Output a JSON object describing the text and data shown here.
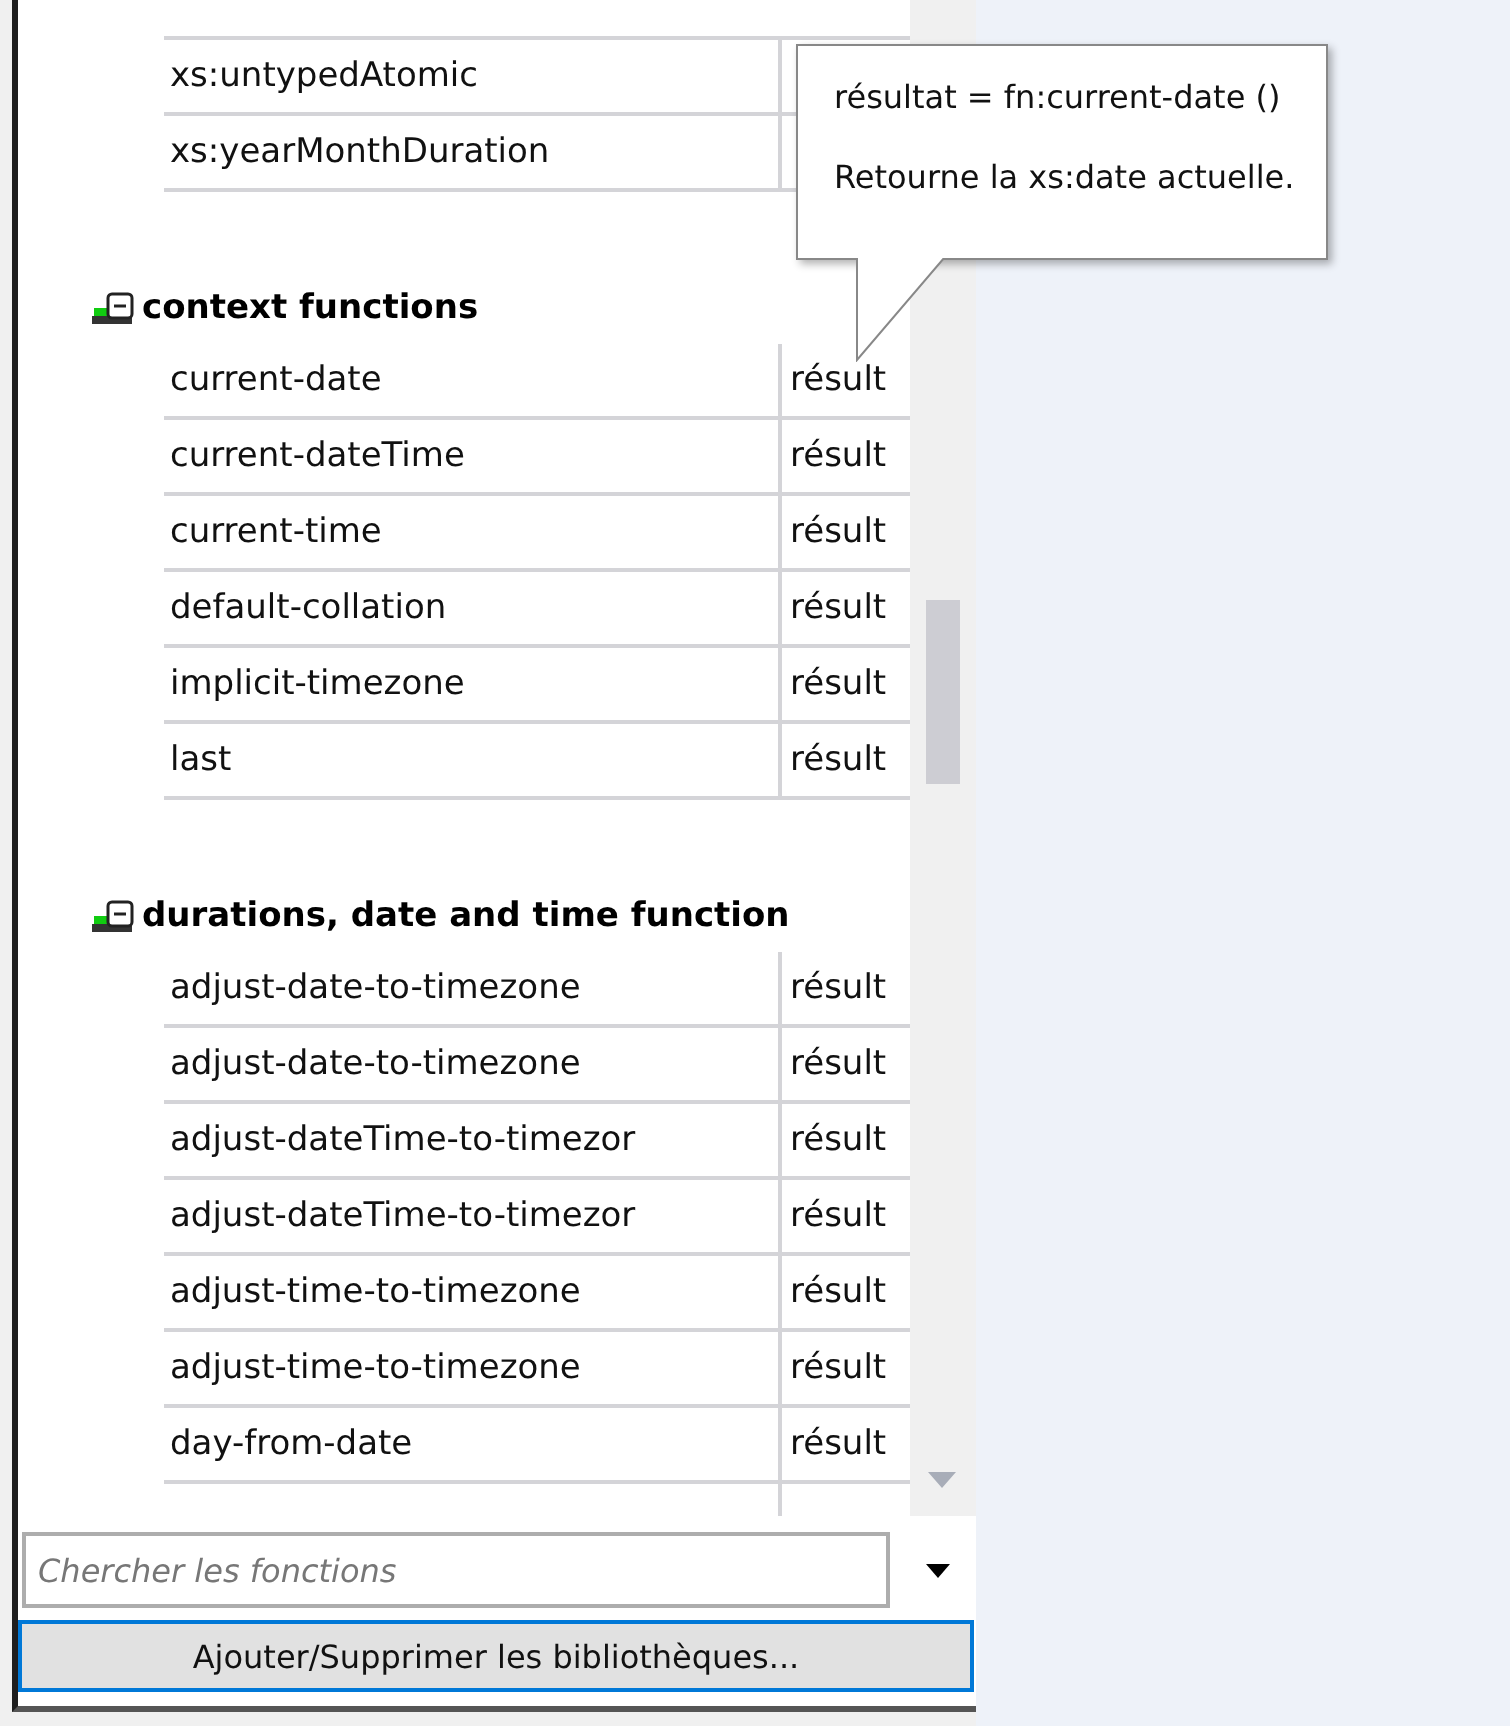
{
  "function_list": {
    "sections": [
      {
        "rows": [
          {
            "name": "xs:untypedAtomic"
          },
          {
            "name": "xs:yearMonthDuration"
          }
        ]
      },
      {
        "title": "context functions",
        "expanded": true,
        "rows": [
          {
            "name": "current-date",
            "result": "résult"
          },
          {
            "name": "current-dateTime",
            "result": "résult"
          },
          {
            "name": "current-time",
            "result": "résult"
          },
          {
            "name": "default-collation",
            "result": "résult"
          },
          {
            "name": "implicit-timezone",
            "result": "résult"
          },
          {
            "name": "last",
            "result": "résult"
          }
        ]
      },
      {
        "title": "durations, date and time function",
        "expanded": true,
        "rows": [
          {
            "name": "adjust-date-to-timezone",
            "result": "résult"
          },
          {
            "name": "adjust-date-to-timezone",
            "result": "résult"
          },
          {
            "name": "adjust-dateTime-to-timezor",
            "result": "résult"
          },
          {
            "name": "adjust-dateTime-to-timezor",
            "result": "résult"
          },
          {
            "name": "adjust-time-to-timezone",
            "result": "résult"
          },
          {
            "name": "adjust-time-to-timezone",
            "result": "résult"
          },
          {
            "name": "day-from-date",
            "result": "résult"
          },
          {
            "name": ""
          }
        ]
      }
    ]
  },
  "tooltip": {
    "lines": [
      "résultat = fn:current-date ()",
      "Retourne la xs:date actuelle."
    ]
  },
  "search": {
    "placeholder": "Chercher les fonctions"
  },
  "libraries_button": "Ajouter/Supprimer les bibliothèques..."
}
